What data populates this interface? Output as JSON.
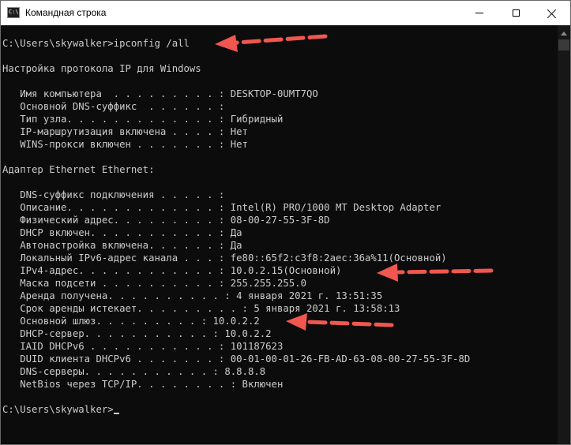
{
  "window": {
    "title": "Командная строка",
    "icon": "cmd-icon",
    "icon_glyph": "C:\\",
    "controls": {
      "minimize": "minimize-icon",
      "maximize": "maximize-icon",
      "close": "close-icon"
    }
  },
  "console": {
    "lines": [
      "C:\\Users\\skywalker>ipconfig /all",
      "",
      "Настройка протокола IP для Windows",
      "",
      "   Имя компьютера  . . . . . . . . . : DESKTOP-0UMT7QO",
      "   Основной DNS-суффикс  . . . . . . :",
      "   Тип узла. . . . . . . . . . . . . : Гибридный",
      "   IP-маршрутизация включена . . . . : Нет",
      "   WINS-прокси включен . . . . . . . : Нет",
      "",
      "Адаптер Ethernet Ethernet:",
      "",
      "   DNS-суффикс подключения . . . . . :",
      "   Описание. . . . . . . . . . . . . : Intel(R) PRO/1000 MT Desktop Adapter",
      "   Физический адрес. . . . . . . . . : 08-00-27-55-3F-8D",
      "   DHCP включен. . . . . . . . . . . : Да",
      "   Автонастройка включена. . . . . . : Да",
      "   Локальный IPv6-адрес канала . . . : fe80::65f2:c3f8:2aec:36a%11(Основной)",
      "   IPv4-адрес. . . . . . . . . . . . : 10.0.2.15(Основной)",
      "   Маска подсети . . . . . . . . . . : 255.255.255.0",
      "   Аренда получена. . . . . . . . . . : 4 января 2021 г. 13:51:35",
      "   Срок аренды истекает. . . . . . . . . : 5 января 2021 г. 13:58:13",
      "   Основной шлюз. . . . . . . . . : 10.0.2.2",
      "   DHCP-сервер. . . . . . . . . . . : 10.0.2.2",
      "   IAID DHCPv6 . . . . . . . . . . . : 101187623",
      "   DUID клиента DHCPv6 . . . . . . . : 00-01-00-01-26-FB-AD-63-08-00-27-55-3F-8D",
      "   DNS-серверы. . . . . . . . . . . : 8.8.8.8",
      "   NetBios через TCP/IP. . . . . . . . : Включен",
      ""
    ],
    "prompt": "C:\\Users\\skywalker>"
  },
  "colors": {
    "console_background": "#0c0c0c",
    "console_text": "#cccccc",
    "annotation_arrow": "#f0574f"
  }
}
